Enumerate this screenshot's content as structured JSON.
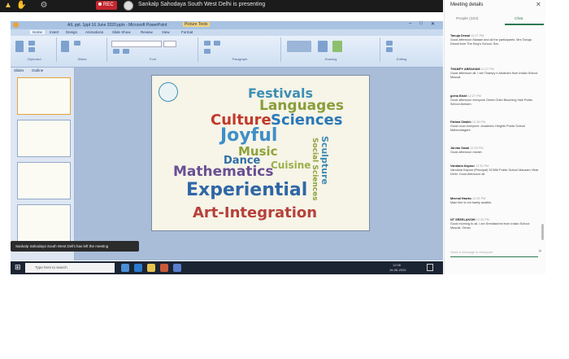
{
  "meeting_bar": {
    "rec_label": "REC",
    "presenting_text": "Sankalp Sahodaya South West Delhi is presenting"
  },
  "ppt": {
    "title": "AIL ppt. 1ppt 16 June 2020.pptx - Microsoft PowerPoint",
    "contextual_tab": "Picture Tools",
    "tabs": [
      "Home",
      "Insert",
      "Design",
      "Animations",
      "Slide Show",
      "Review",
      "View",
      "Format"
    ],
    "ribbon_groups": [
      "Clipboard",
      "Slides",
      "Font",
      "Paragraph",
      "Drawing",
      "Editing"
    ],
    "pane_tabs": [
      "Slides",
      "Outline"
    ],
    "slide_words": [
      {
        "text": "Festivals",
        "color": "#3d8fb5"
      },
      {
        "text": "Languages",
        "color": "#8a9e3b"
      },
      {
        "text": "Culture",
        "color": "#c0392b"
      },
      {
        "text": "Sciences",
        "color": "#2a78b8"
      },
      {
        "text": "Joyful",
        "color": "#3f8fc9"
      },
      {
        "text": "Music",
        "color": "#8ea33a"
      },
      {
        "text": "Dance",
        "color": "#2f6fa8"
      },
      {
        "text": "Cuisine",
        "color": "#9ab04a"
      },
      {
        "text": "Mathematics",
        "color": "#6a4f93"
      },
      {
        "text": "Experiential",
        "color": "#2f67a6"
      },
      {
        "text": "Art-Integration",
        "color": "#b5413a"
      },
      {
        "text": "Sculpture",
        "color": "#3c8bb3"
      },
      {
        "text": "Social Sciences",
        "color": "#8da43c"
      }
    ],
    "toast_text": "Sankalp Sahodaya South West Delhi has left the meeting"
  },
  "taskbar": {
    "search_placeholder": "Type here to search",
    "time": "12:06",
    "date": "16-06-2020"
  },
  "panel": {
    "title": "Meeting details",
    "tabs": [
      "People (334)",
      "Chat"
    ],
    "messages": [
      {
        "name": "Tanuja Dewal",
        "time": "12:27 PM",
        "text": "Good afternoon Madam and all the participants. Mrs Tanuja Dewal from The King's School, Sec."
      },
      {
        "name": "THAMPY ABRAHAM",
        "time": "12:27 PM",
        "text": "Good afternoon all. I am Thampy k Abraham from Indian School Muscat."
      },
      {
        "name": "geeta Bisht",
        "time": "12:27 PM",
        "text": "Good afternoon everyone Geeta Orkin Blooming Vale Public School Ashram"
      },
      {
        "name": "Fatima Shaikh",
        "time": "12:28 PM",
        "text": "Good noon everyone. Academic Heights Public School Mahendragarh"
      },
      {
        "name": "Jarvan Saxal",
        "time": "12:29 PM",
        "text": "Good afternoon ma'am"
      },
      {
        "name": "Vandana Kapoor",
        "time": "12:33 PM",
        "text": "Vandana Kapoor (Principal) SCMM Public School Mausam Vihar Delhi. Good Afternoon all"
      },
      {
        "name": "Meenal Hawks",
        "time": "12:33 PM",
        "text": "Mam line is not barely audible."
      },
      {
        "name": "NT SREELAKSHI",
        "time": "12:33 PM",
        "text": "Good morning to all. I am Sreelakshmi from Indian School Muscat, Oman"
      }
    ],
    "input_placeholder": "Send a message to everyone"
  }
}
